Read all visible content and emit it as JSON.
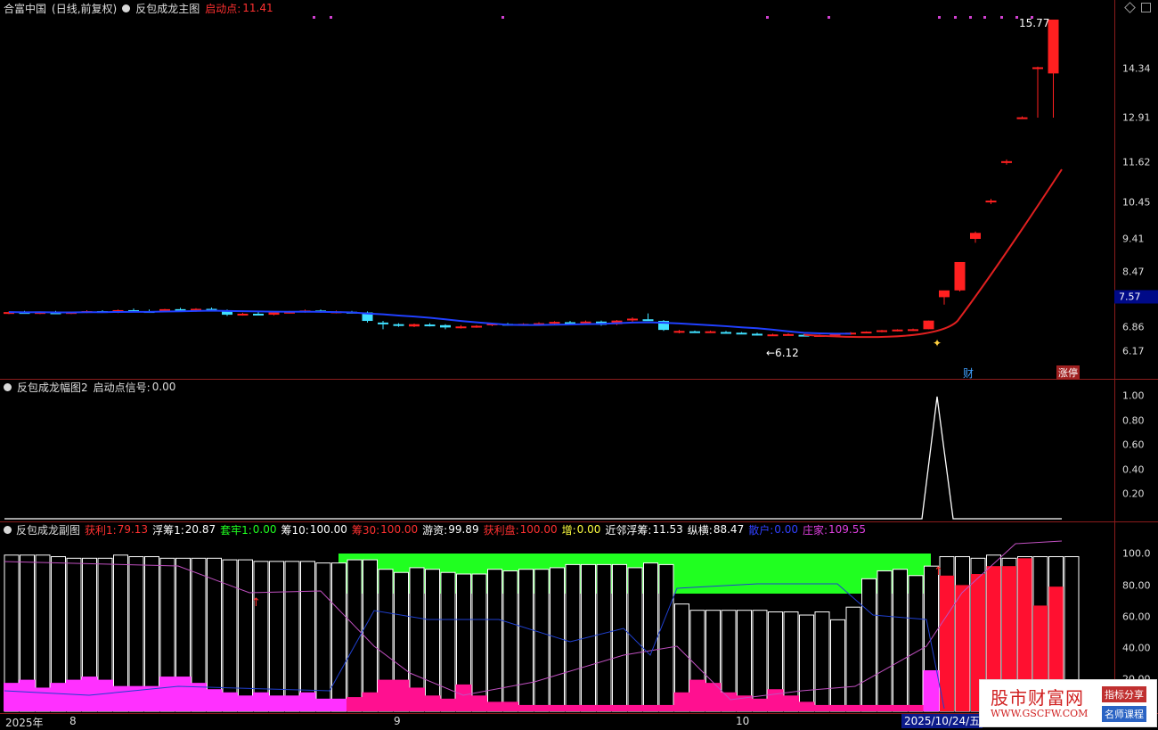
{
  "main": {
    "stock": "合富中国",
    "mode": "(日线,前复权)",
    "indicator": "反包成龙主图",
    "start_label": "启动点:",
    "start_value": "11.41",
    "price_axis": [
      "14.34",
      "12.91",
      "11.62",
      "10.45",
      "9.41",
      "8.47",
      "7.57",
      "6.86",
      "6.17"
    ],
    "current_price": "7.57",
    "high_label": "15.77",
    "low_label": "←6.12",
    "tag_cai": "财",
    "tag_zhangting": "涨停",
    "colors": {
      "up": "#ff2020",
      "down": "#40e0ff",
      "ma_blue": "#2040ff",
      "ma_red": "#e02020"
    }
  },
  "sub1": {
    "indicator": "反包成龙幅图2",
    "signal_label": "启动点信号:",
    "signal_value": "0.00",
    "axis": [
      "1.00",
      "0.80",
      "0.60",
      "0.40",
      "0.20"
    ]
  },
  "sub2": {
    "indicator": "反包成龙副图",
    "stats": [
      {
        "label": "获利1:",
        "value": "79.13",
        "color": "#ff3030"
      },
      {
        "label": "浮筹1:",
        "value": "20.87",
        "color": "#ffffff"
      },
      {
        "label": "套牢1:",
        "value": "0.00",
        "color": "#20ff20"
      },
      {
        "label": "筹10:",
        "value": "100.00",
        "color": "#ffffff"
      },
      {
        "label": "筹30:",
        "value": "100.00",
        "color": "#ff3030"
      },
      {
        "label": "游资:",
        "value": "99.89",
        "color": "#ffffff"
      },
      {
        "label": "获利盘:",
        "value": "100.00",
        "color": "#ff3030"
      },
      {
        "label": "增:",
        "value": "0.00",
        "color": "#ffff40"
      },
      {
        "label": "近邻浮筹:",
        "value": "11.53",
        "color": "#ffffff"
      },
      {
        "label": "纵横:",
        "value": "88.47",
        "color": "#ffffff"
      },
      {
        "label": "散户:",
        "value": "0.00",
        "color": "#3040ff"
      },
      {
        "label": "庄家:",
        "value": "109.55",
        "color": "#e040e0"
      }
    ],
    "axis": [
      "100.0",
      "80.00",
      "60.00",
      "40.00",
      "20.00"
    ]
  },
  "xaxis": {
    "labels": [
      "2025年",
      "8",
      "9",
      "10"
    ],
    "selected": "2025/10/24/五"
  },
  "watermark": {
    "main": "股市财富网",
    "url": "WWW.GSCFW.COM",
    "tag1": "指标分享",
    "tag2": "名师课程"
  },
  "chart_data": {
    "type": "candlestick",
    "price_range": [
      6.12,
      15.77
    ],
    "candles": [
      [
        7.3,
        7.34,
        7.26,
        7.32
      ],
      [
        7.32,
        7.36,
        7.28,
        7.31
      ],
      [
        7.3,
        7.33,
        7.26,
        7.32
      ],
      [
        7.31,
        7.36,
        7.28,
        7.29
      ],
      [
        7.28,
        7.33,
        7.26,
        7.32
      ],
      [
        7.32,
        7.38,
        7.29,
        7.35
      ],
      [
        7.35,
        7.38,
        7.3,
        7.31
      ],
      [
        7.32,
        7.4,
        7.29,
        7.38
      ],
      [
        7.38,
        7.43,
        7.34,
        7.36
      ],
      [
        7.35,
        7.4,
        7.3,
        7.33
      ],
      [
        7.34,
        7.42,
        7.31,
        7.41
      ],
      [
        7.41,
        7.45,
        7.36,
        7.38
      ],
      [
        7.38,
        7.44,
        7.33,
        7.42
      ],
      [
        7.42,
        7.46,
        7.37,
        7.38
      ],
      [
        7.37,
        7.4,
        7.2,
        7.24
      ],
      [
        7.24,
        7.3,
        7.21,
        7.27
      ],
      [
        7.27,
        7.34,
        7.22,
        7.24
      ],
      [
        7.24,
        7.33,
        7.22,
        7.31
      ],
      [
        7.31,
        7.36,
        7.28,
        7.33
      ],
      [
        7.33,
        7.4,
        7.3,
        7.37
      ],
      [
        7.37,
        7.4,
        7.3,
        7.32
      ],
      [
        7.32,
        7.37,
        7.28,
        7.34
      ],
      [
        7.33,
        7.36,
        7.28,
        7.3
      ],
      [
        7.31,
        7.34,
        7.0,
        7.05
      ],
      [
        7.0,
        7.05,
        6.8,
        6.98
      ],
      [
        6.95,
        6.98,
        6.87,
        6.9
      ],
      [
        6.88,
        6.97,
        6.86,
        6.95
      ],
      [
        6.94,
        6.98,
        6.88,
        6.92
      ],
      [
        6.92,
        6.95,
        6.8,
        6.85
      ],
      [
        6.87,
        6.92,
        6.82,
        6.88
      ],
      [
        6.88,
        6.92,
        6.84,
        6.9
      ],
      [
        6.92,
        6.98,
        6.89,
        6.97
      ],
      [
        6.96,
        6.99,
        6.9,
        6.93
      ],
      [
        6.93,
        6.98,
        6.9,
        6.96
      ],
      [
        6.96,
        7.01,
        6.93,
        6.98
      ],
      [
        6.98,
        7.04,
        6.95,
        7.02
      ],
      [
        7.01,
        7.05,
        6.97,
        7.0
      ],
      [
        7.0,
        7.06,
        6.97,
        7.03
      ],
      [
        7.03,
        7.06,
        6.9,
        6.93
      ],
      [
        6.95,
        7.08,
        6.92,
        7.06
      ],
      [
        7.1,
        7.16,
        7.02,
        7.12
      ],
      [
        7.1,
        7.28,
        7.05,
        7.05
      ],
      [
        7.05,
        7.08,
        6.75,
        6.78
      ],
      [
        6.73,
        6.78,
        6.68,
        6.75
      ],
      [
        6.74,
        6.76,
        6.7,
        6.72
      ],
      [
        6.73,
        6.76,
        6.69,
        6.74
      ],
      [
        6.72,
        6.75,
        6.68,
        6.71
      ],
      [
        6.7,
        6.72,
        6.66,
        6.68
      ],
      [
        6.67,
        6.7,
        6.62,
        6.66
      ],
      [
        6.64,
        6.67,
        6.61,
        6.65
      ],
      [
        6.64,
        6.68,
        6.62,
        6.66
      ],
      [
        6.64,
        6.66,
        6.6,
        6.61
      ],
      [
        6.62,
        6.65,
        6.6,
        6.63
      ],
      [
        6.63,
        6.68,
        6.61,
        6.67
      ],
      [
        6.67,
        6.72,
        6.64,
        6.7
      ],
      [
        6.7,
        6.74,
        6.68,
        6.73
      ],
      [
        6.73,
        6.78,
        6.71,
        6.77
      ],
      [
        6.77,
        6.8,
        6.74,
        6.79
      ],
      [
        6.79,
        6.82,
        6.75,
        6.8
      ],
      [
        6.8,
        7.06,
        6.8,
        7.06
      ],
      [
        7.76,
        7.8,
        7.55,
        7.95
      ],
      [
        7.95,
        8.75,
        7.92,
        8.75
      ],
      [
        9.41,
        9.62,
        9.3,
        9.58
      ],
      [
        10.45,
        10.55,
        10.4,
        10.5
      ],
      [
        11.62,
        11.7,
        11.55,
        11.65
      ],
      [
        12.91,
        12.95,
        12.88,
        12.92
      ],
      [
        14.34,
        14.4,
        12.91,
        14.38
      ],
      [
        14.2,
        15.77,
        12.91,
        15.77
      ]
    ]
  }
}
